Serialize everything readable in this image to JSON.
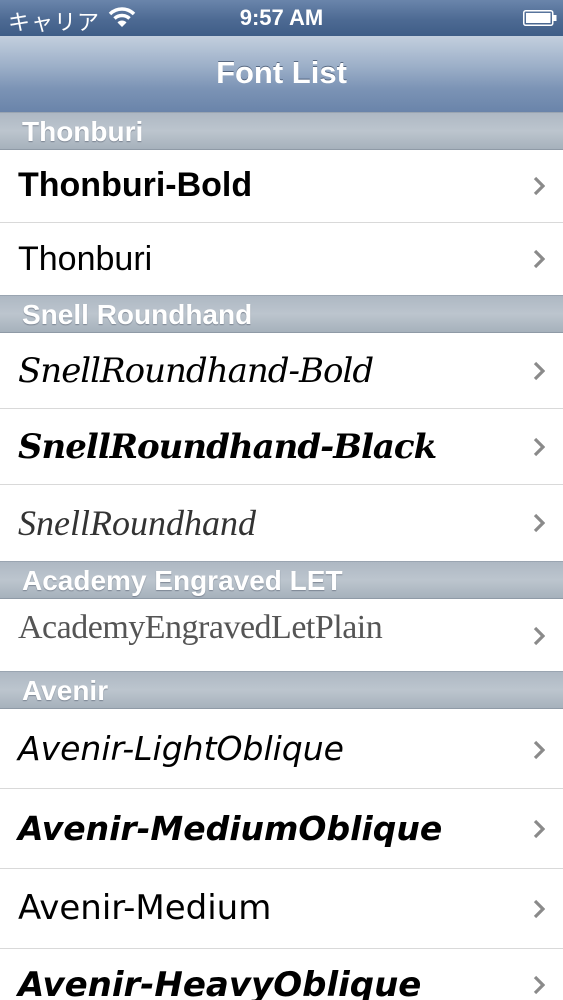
{
  "status_bar": {
    "carrier": "キャリア",
    "time": "9:57 AM",
    "icons": [
      "wifi-icon",
      "battery-icon"
    ]
  },
  "nav": {
    "title": "Font List"
  },
  "sections": [
    {
      "header": "Thonburi",
      "rows": [
        "Thonburi-Bold",
        "Thonburi"
      ]
    },
    {
      "header": "Snell Roundhand",
      "rows": [
        "SnellRoundhand-Bold",
        "SnellRoundhand-Black",
        "SnellRoundhand"
      ]
    },
    {
      "header": "Academy Engraved LET",
      "rows": [
        "AcademyEngravedLetPlain"
      ]
    },
    {
      "header": "Avenir",
      "rows": [
        "Avenir-LightOblique",
        "Avenir-MediumOblique",
        "Avenir-Medium",
        "Avenir-HeavyOblique"
      ]
    }
  ],
  "colors": {
    "nav_bar": "#7b93b5",
    "section_header": "#b3bdc8",
    "chevron": "#8a8a8a"
  }
}
